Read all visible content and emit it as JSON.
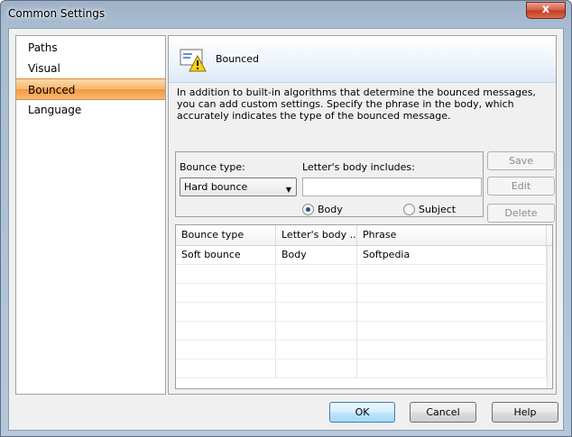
{
  "window": {
    "title": "Common Settings",
    "close_glyph": "x"
  },
  "nav": {
    "items": [
      {
        "label": "Paths",
        "selected": false
      },
      {
        "label": "Visual",
        "selected": false
      },
      {
        "label": "Bounced",
        "selected": true
      },
      {
        "label": "Language",
        "selected": false
      }
    ]
  },
  "panel": {
    "title": "Bounced",
    "icon": "bounced-letter-warning-icon",
    "description": "In addition to built-in algorithms that determine the bounced messages, you can add custom settings. Specify the phrase in the body, which accurately indicates the type of the bounced message."
  },
  "form": {
    "bounce_type_label": "Bounce type:",
    "bounce_type_value": "Hard bounce",
    "arrow_glyph": "▼",
    "body_includes_label": "Letter's body includes:",
    "phrase_value": "",
    "radio_body": "Body",
    "radio_subject": "Subject",
    "selected_radio": "Body"
  },
  "side_buttons": {
    "save": "Save",
    "edit": "Edit",
    "delete": "Delete"
  },
  "table": {
    "columns": [
      "Bounce type",
      "Letter's body ...",
      "Phrase"
    ],
    "rows": [
      [
        "Soft bounce",
        "Body",
        "Softpedia"
      ]
    ]
  },
  "footer": {
    "ok": "OK",
    "cancel": "Cancel",
    "help": "Help"
  },
  "colors": {
    "selected_nav": "#f39a3c",
    "header_gradient_end": "#dce9f7",
    "radio_dot": "#2a4a8a"
  }
}
